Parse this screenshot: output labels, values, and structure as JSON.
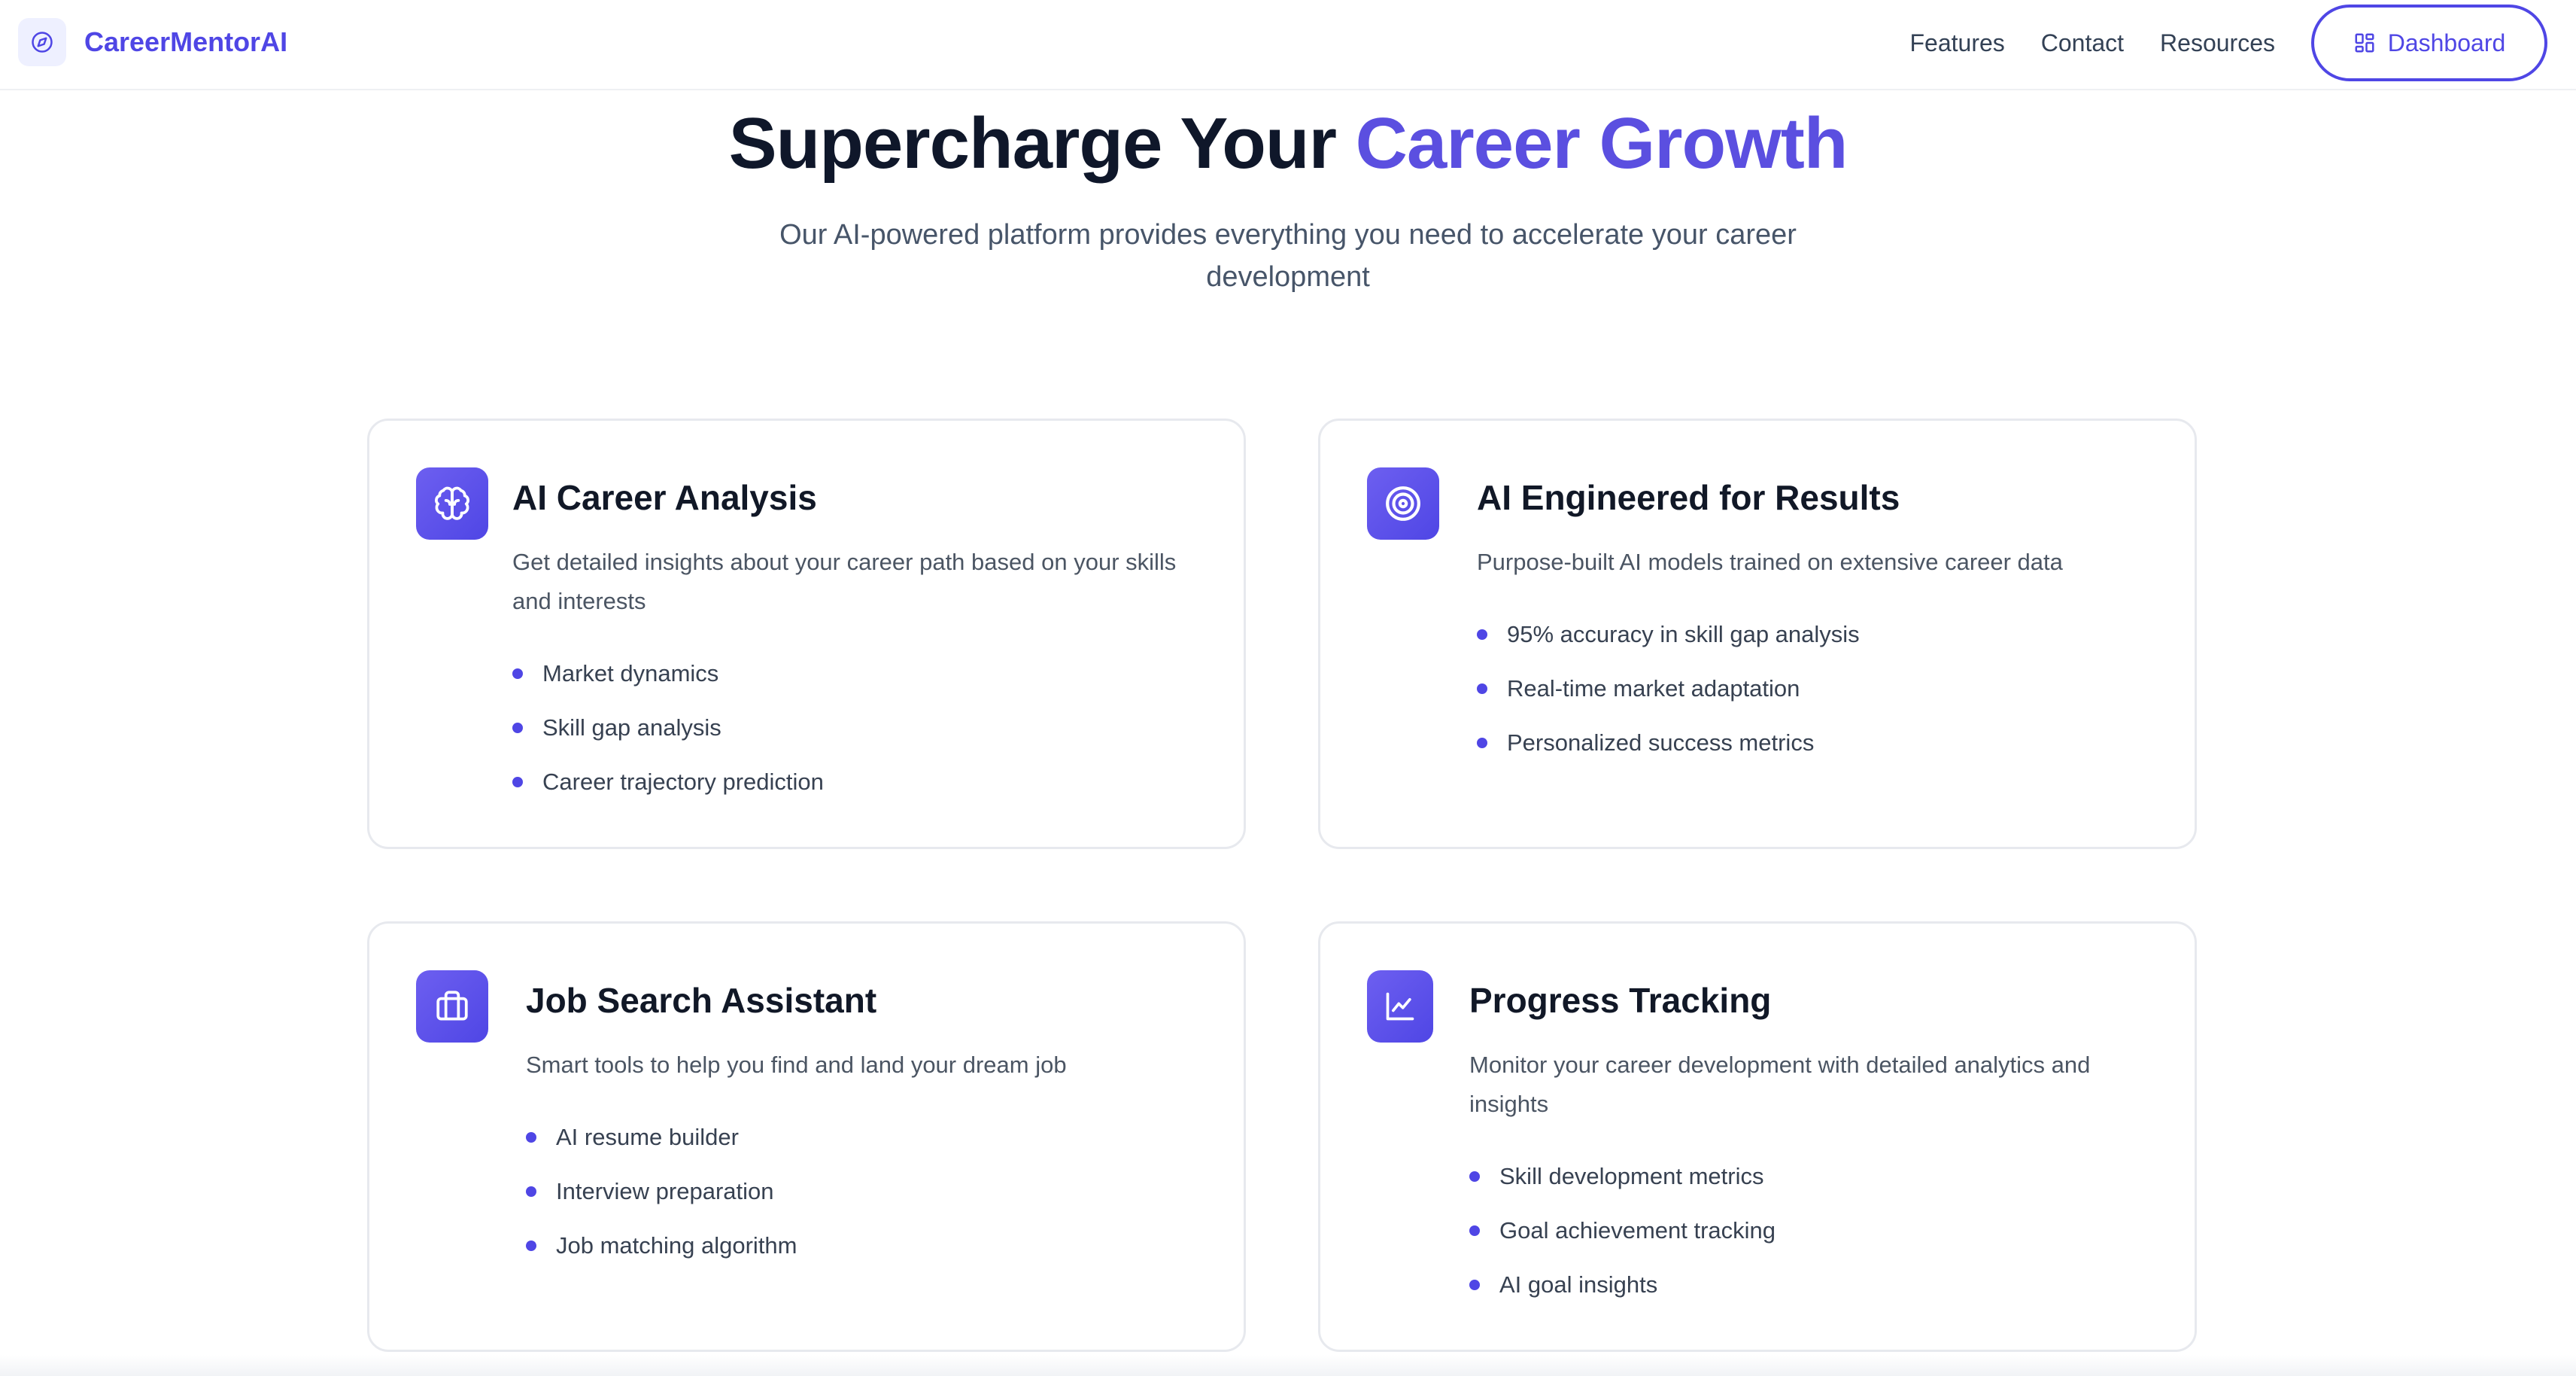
{
  "header": {
    "brand_name": "CareerMentorAI",
    "nav": [
      "Features",
      "Contact",
      "Resources"
    ],
    "dashboard_label": "Dashboard"
  },
  "hero": {
    "title_plain": "Supercharge Your ",
    "title_accent": "Career Growth",
    "subtitle": "Our AI-powered platform provides everything you need to accelerate your career development"
  },
  "cards": [
    {
      "icon": "brain-icon",
      "title": "AI Career Analysis",
      "description": "Get detailed insights about your career path based on your skills and interests",
      "items": [
        "Market dynamics",
        "Skill gap analysis",
        "Career trajectory prediction"
      ]
    },
    {
      "icon": "target-icon",
      "title": "AI Engineered for Results",
      "description": "Purpose-built AI models trained on extensive career data",
      "items": [
        "95% accuracy in skill gap analysis",
        "Real-time market adaptation",
        "Personalized success metrics"
      ]
    },
    {
      "icon": "briefcase-icon",
      "title": "Job Search Assistant",
      "description": "Smart tools to help you find and land your dream job",
      "items": [
        "AI resume builder",
        "Interview preparation",
        "Job matching algorithm"
      ]
    },
    {
      "icon": "line-chart-icon",
      "title": "Progress Tracking",
      "description": "Monitor your career development with detailed analytics and insights",
      "items": [
        "Skill development metrics",
        "Goal achievement tracking",
        "AI goal insights"
      ]
    }
  ],
  "colors": {
    "accent": "#4f46e5",
    "heading": "#0f172a",
    "body_text": "#475569",
    "card_border": "#e7e9ee"
  }
}
